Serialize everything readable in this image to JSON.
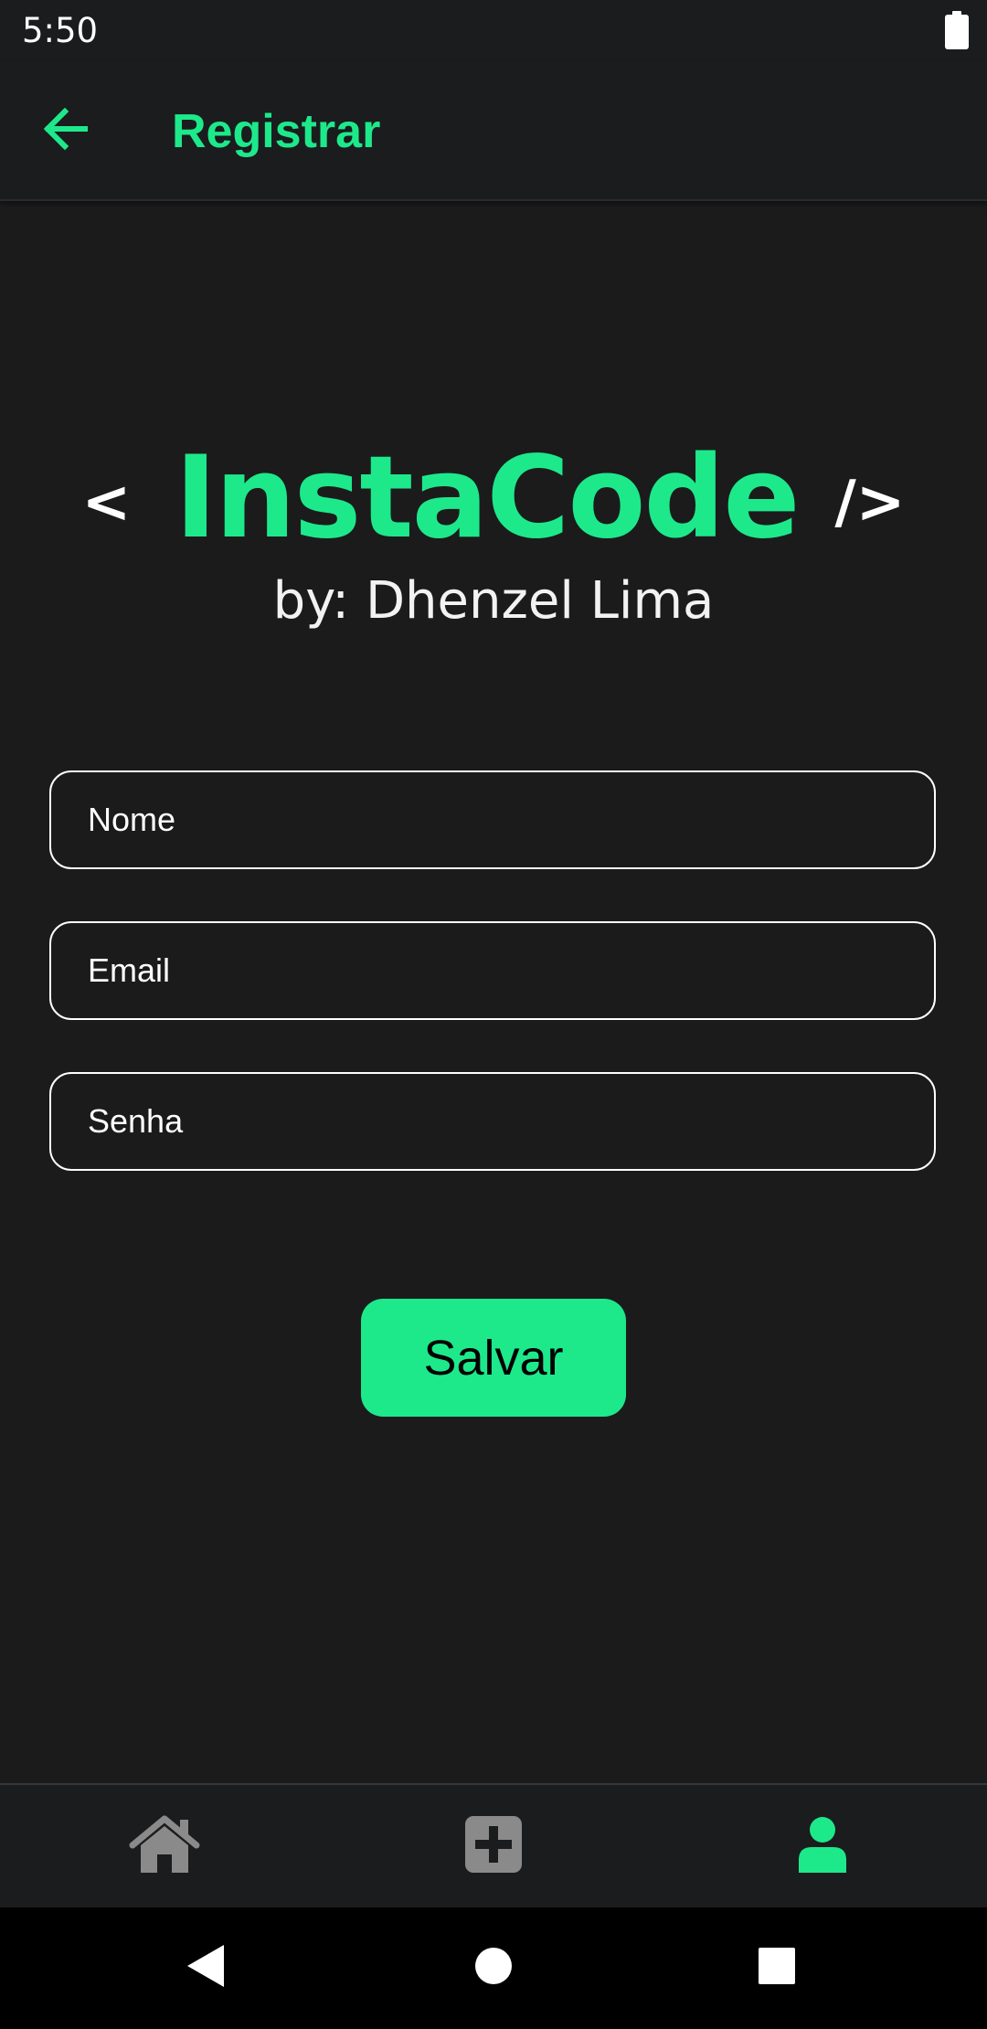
{
  "status_bar": {
    "time": "5:50",
    "battery_icon": "battery-full-icon"
  },
  "app_bar": {
    "back_icon": "arrow-left-icon",
    "title": "Registrar"
  },
  "logo": {
    "bracket_open": "<",
    "name": "InstaCode",
    "bracket_close": "/>",
    "byline": "by: Dhenzel Lima"
  },
  "form": {
    "name_placeholder": "Nome",
    "email_placeholder": "Email",
    "password_placeholder": "Senha",
    "save_label": "Salvar"
  },
  "bottom_nav": {
    "items": [
      {
        "icon": "home-icon",
        "active": false
      },
      {
        "icon": "plus-square-icon",
        "active": false
      },
      {
        "icon": "user-icon",
        "active": true
      }
    ]
  },
  "system_nav": {
    "back_icon": "triangle-back-icon",
    "home_icon": "circle-home-icon",
    "recents_icon": "square-recents-icon"
  },
  "colors": {
    "accent": "#1de98b",
    "background": "#1b1b1c",
    "bar_background": "#1b1c1e",
    "inactive_icon": "#8a8a8a",
    "text": "#ffffff"
  }
}
